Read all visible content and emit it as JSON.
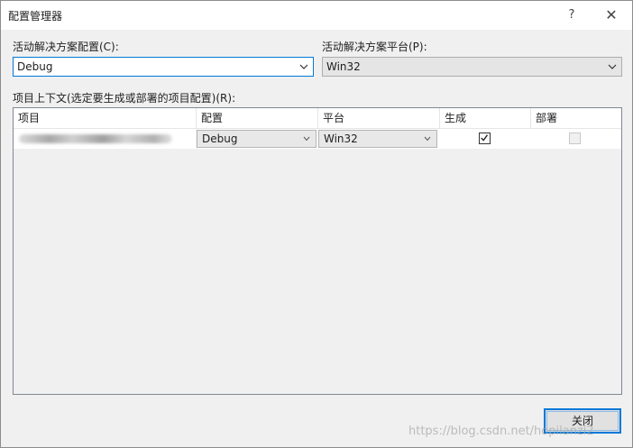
{
  "window": {
    "title": "配置管理器",
    "help_glyph": "?",
    "close_glyph": "✕"
  },
  "active_config": {
    "label": "活动解决方案配置(C):",
    "value": "Debug"
  },
  "active_platform": {
    "label": "活动解决方案平台(P):",
    "value": "Win32"
  },
  "context": {
    "label": "项目上下文(选定要生成或部署的项目配置)(R):",
    "columns": [
      "项目",
      "配置",
      "平台",
      "生成",
      "部署"
    ],
    "rows": [
      {
        "project": "",
        "config": "Debug",
        "platform": "Win32",
        "build": true,
        "deploy": false
      }
    ]
  },
  "close_button": {
    "label": "关闭"
  },
  "watermark": "https://blog.csdn.net/hopilanzi2"
}
